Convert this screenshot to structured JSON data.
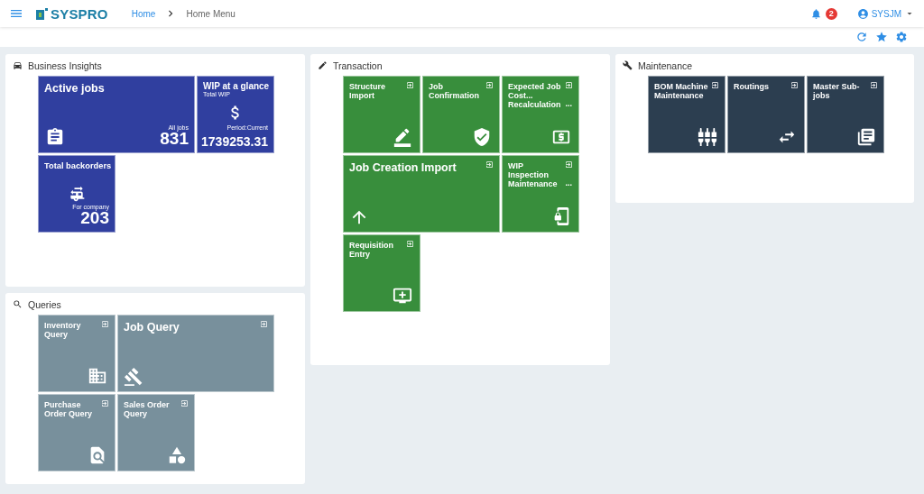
{
  "header": {
    "brand": "SYSPRO",
    "breadcrumb": [
      {
        "label": "Home",
        "selected": false
      },
      {
        "label": "Home Menu",
        "selected": true
      }
    ],
    "notifications": "2",
    "user": "SYSJM"
  },
  "panels": [
    {
      "title": "Business Insights",
      "color": "#303f9f",
      "tiles": [
        {
          "kind": "kpi",
          "title": "Active jobs",
          "wide": true,
          "caption": "All jobs",
          "value": "831"
        },
        {
          "kind": "kpi",
          "title": "WIP at a glance",
          "subtitle": "Total WIP",
          "caption": "Period:Current",
          "value": "1739253.31"
        },
        {
          "kind": "kpi",
          "title": "Total backorders",
          "caption": "For company",
          "value": "203"
        }
      ]
    },
    {
      "title": "Queries",
      "color": "#78909c",
      "tiles": [
        {
          "kind": "program",
          "title": "Inventory Query"
        },
        {
          "kind": "program",
          "title": "Job Query",
          "wide": true
        },
        {
          "kind": "program",
          "title": "Purchase Order Query"
        },
        {
          "kind": "program",
          "title": "Sales Order Query"
        }
      ]
    },
    {
      "title": "Transaction",
      "color": "#388e3c",
      "tiles": [
        {
          "kind": "program",
          "title": "Structure Import"
        },
        {
          "kind": "program",
          "title": "Job Confirmation"
        },
        {
          "kind": "program",
          "title": "Expected Job Cost... Recalculation",
          "more": "..."
        },
        {
          "kind": "program",
          "title": "Job Creation Import",
          "wide": true
        },
        {
          "kind": "program",
          "title": "WIP Inspection Maintenance",
          "more": "..."
        },
        {
          "kind": "program",
          "title": "Requisition Entry"
        }
      ]
    },
    {
      "title": "Maintenance",
      "color": "#2c3e50",
      "tiles": [
        {
          "kind": "program",
          "title": "BOM Machine Maintenance"
        },
        {
          "kind": "program",
          "title": "Routings"
        },
        {
          "kind": "program",
          "title": "Master Sub-jobs"
        }
      ]
    }
  ]
}
